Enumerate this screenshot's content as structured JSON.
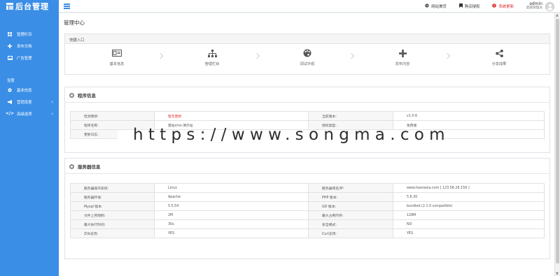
{
  "logo": {
    "text": "后台管理"
  },
  "sidebar": {
    "items": [
      {
        "label": "管理栏目",
        "icon": "grid-icon"
      },
      {
        "label": "发布文档",
        "icon": "plus-icon"
      },
      {
        "label": "广告管理",
        "icon": "image-icon"
      }
    ],
    "group_label": "设置",
    "settings_items": [
      {
        "label": "基本信息",
        "icon": "gear-icon"
      },
      {
        "label": "营销设置",
        "icon": "megaphone-icon"
      },
      {
        "label": "高级选项",
        "icon": "code-icon"
      }
    ]
  },
  "topbar": {
    "links": [
      {
        "label": "网站首页",
        "icon": "globe-icon"
      },
      {
        "label": "购买授权",
        "icon": "bookmark-icon"
      },
      {
        "label": "系统更新",
        "icon": "alert-icon"
      }
    ],
    "user": {
      "name": "admin",
      "role": "超级管理员"
    }
  },
  "page": {
    "title": "管理中心"
  },
  "quick": {
    "title": "快捷入口",
    "items": [
      {
        "label": "基本信息",
        "icon": "id-card-icon"
      },
      {
        "label": "管理栏目",
        "icon": "sitemap-icon"
      },
      {
        "label": "调试外观",
        "icon": "palette-icon"
      },
      {
        "label": "发布内容",
        "icon": "plus-icon"
      },
      {
        "label": "分享成果",
        "icon": "share-icon"
      }
    ]
  },
  "program": {
    "title": "程序信息",
    "rows": [
      [
        "检测更新:",
        "暂无更新",
        "当前版本:",
        "v1.0.6"
      ],
      [
        "程序名称:",
        "建站cms-演示站",
        "授权类型:",
        "免费版"
      ],
      [
        "更新日志:",
        "",
        "",
        ""
      ]
    ]
  },
  "server": {
    "title": "服务器信息",
    "rows": [
      [
        "服务器操作系统:",
        "Linux",
        "服务器域名/IP:",
        "www.haixiaxia.com [ 123.56.26.159 ]"
      ],
      [
        "服务器环境:",
        "Apache",
        "PHP 版本:",
        "5.6.30"
      ],
      [
        "Mysql 版本:",
        "5.5.54",
        "GD 版本:",
        "bundled (2.1.0 compatible)"
      ],
      [
        "文件上传限制:",
        "2M",
        "最大占用内存:",
        "128M"
      ],
      [
        "最大执行时间:",
        "30s",
        "安全模式:",
        "NO"
      ],
      [
        "Zlib支持:",
        "YES",
        "Curl支持:",
        "YES"
      ]
    ]
  },
  "watermark": "https://www.songma.com",
  "colors": {
    "accent": "#3a8ee6",
    "alert": "#e02d2d"
  }
}
